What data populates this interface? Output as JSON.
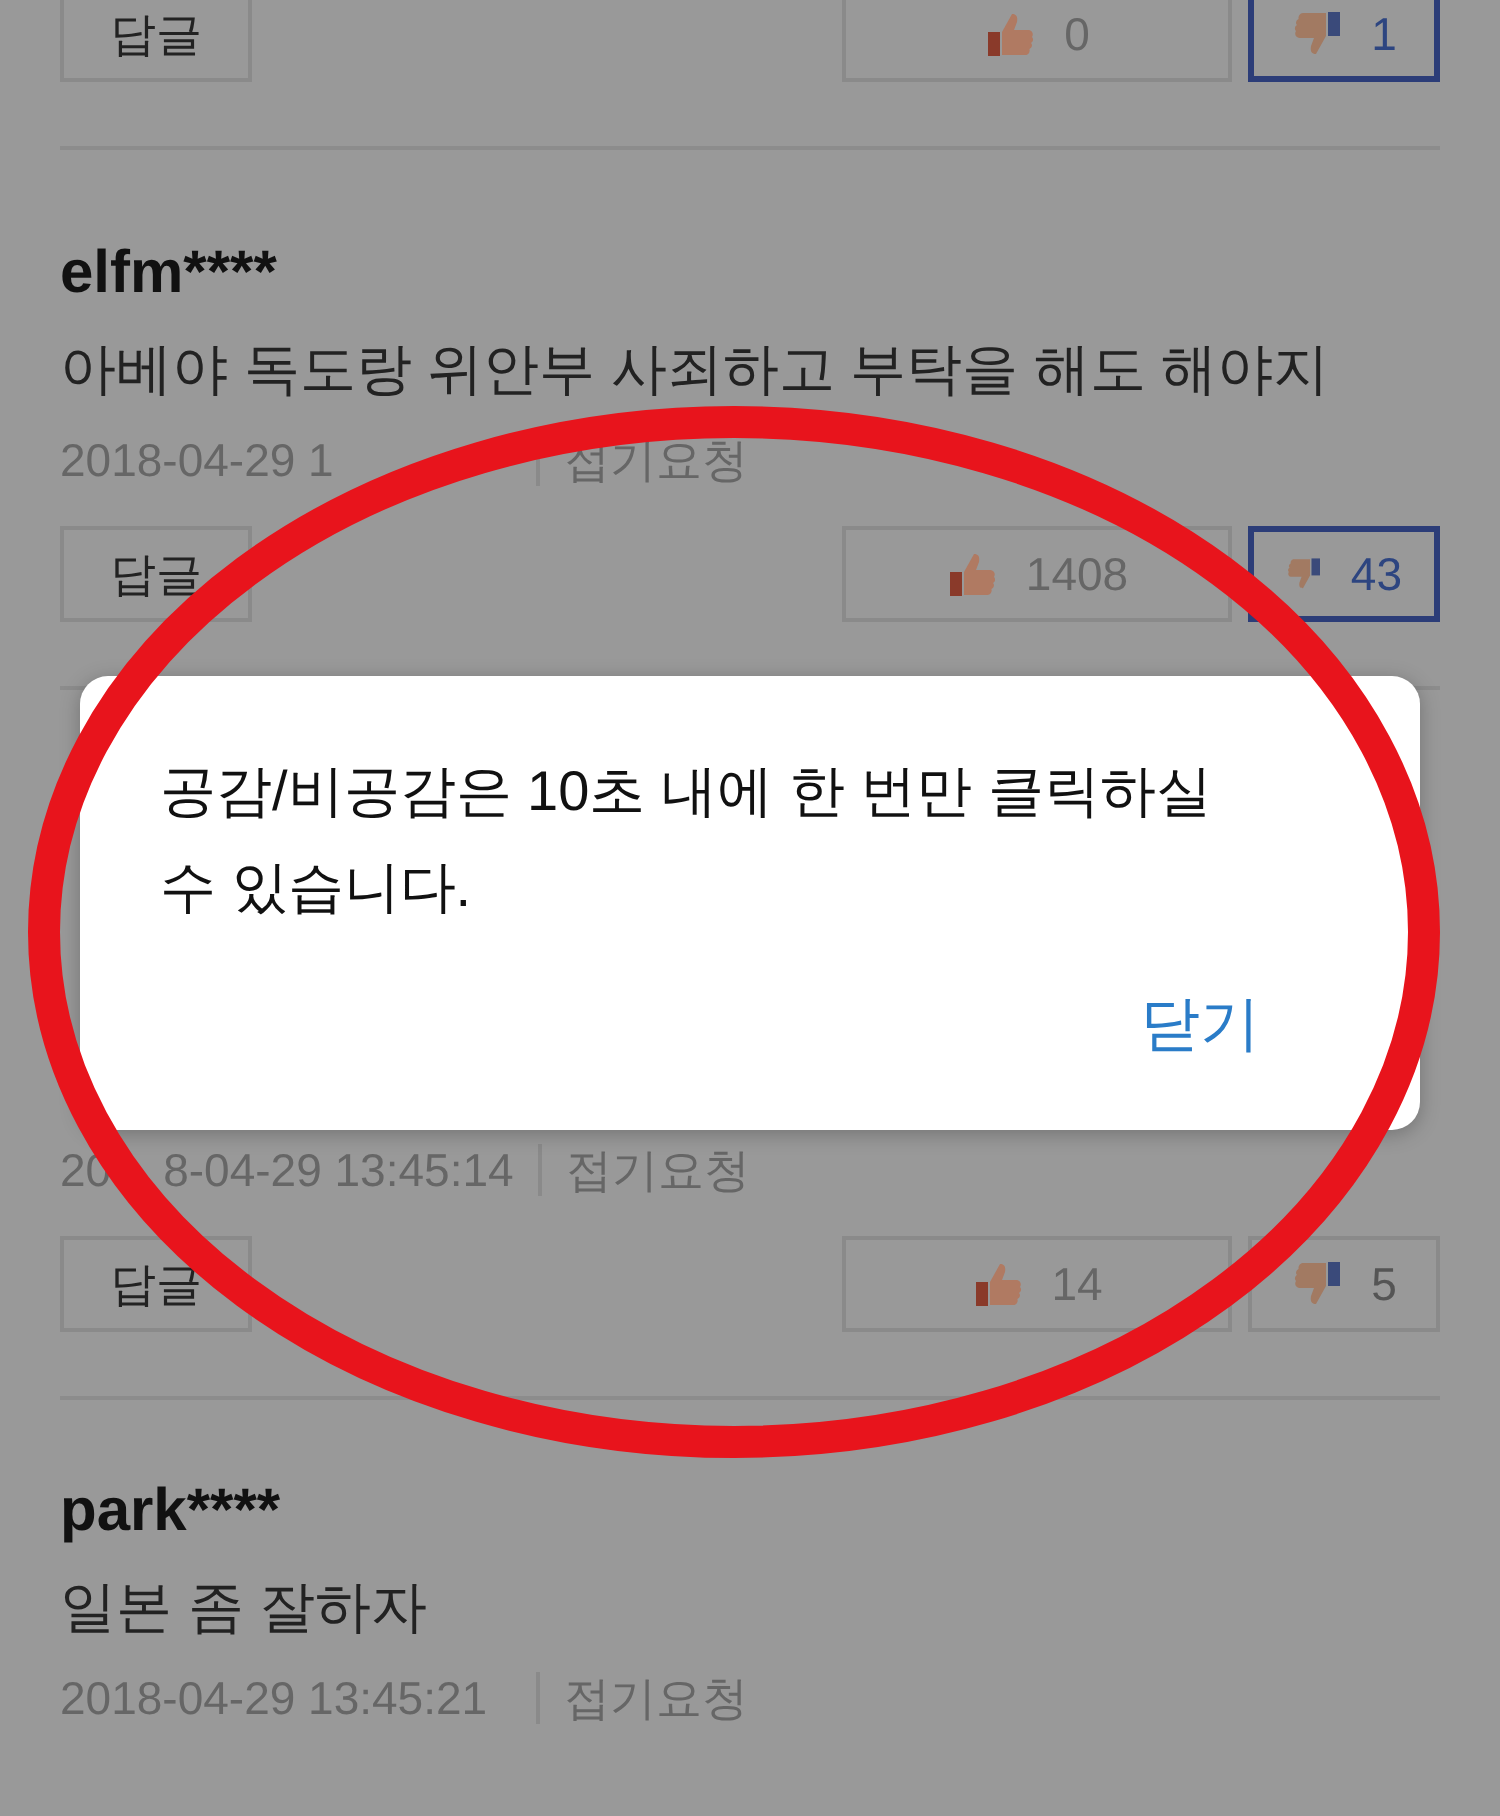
{
  "comments": [
    {
      "reply": "답글",
      "likes": "0",
      "dislikes": "1",
      "disliked": true
    },
    {
      "author": "elfm****",
      "text": "아베야 독도랑 위안부 사죄하고 부탁을 해도 해야지",
      "date": "2018-04-29 1",
      "fold": "접기요청",
      "reply": "답글",
      "likes": "1408",
      "dislikes": "43",
      "disliked": true
    },
    {
      "date": "20",
      "date_rest": "8-04-29 13:45:14",
      "fold": "접기요청",
      "reply": "답글",
      "likes": "14",
      "dislikes": "5",
      "disliked": false
    },
    {
      "author": "park****",
      "text": "일본 좀 잘하자",
      "date": "2018-04-29 13:45:21",
      "fold": "접기요청"
    }
  ],
  "dialog": {
    "message": "공감/비공감은 10초 내에 한 번만 클릭하실 수 있습니다.",
    "close": "닫기"
  }
}
